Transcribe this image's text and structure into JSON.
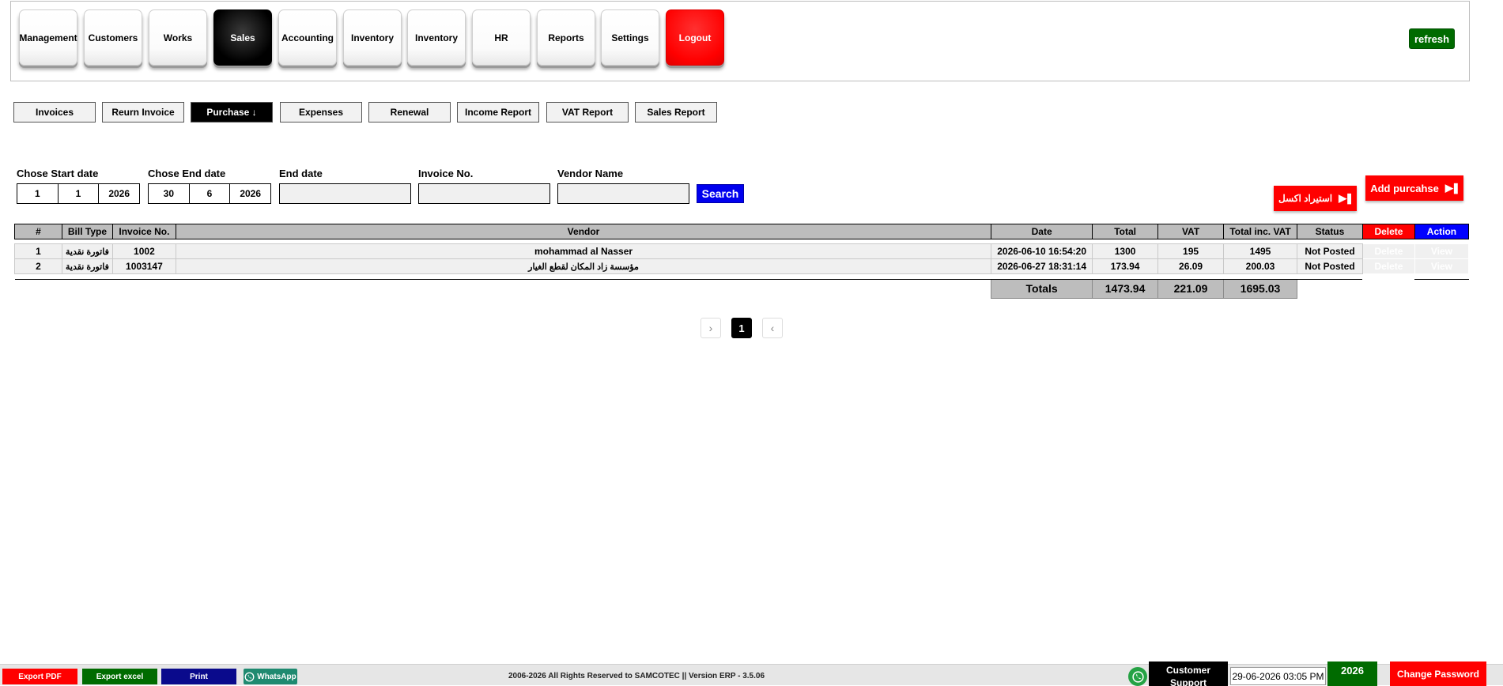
{
  "nav": {
    "items": [
      {
        "label": "Management"
      },
      {
        "label": "Customers"
      },
      {
        "label": "Works"
      },
      {
        "label": "Sales"
      },
      {
        "label": "Accounting"
      },
      {
        "label": "Inventory"
      },
      {
        "label": "Inventory"
      },
      {
        "label": "HR"
      },
      {
        "label": "Reports"
      },
      {
        "label": "Settings"
      }
    ],
    "logout": "Logout",
    "refresh": "refresh"
  },
  "subtabs": [
    {
      "label": "Invoices"
    },
    {
      "label": "Reurn Invoice"
    },
    {
      "label": "Purchase ↓"
    },
    {
      "label": "Expenses"
    },
    {
      "label": "Renewal"
    },
    {
      "label": "Income Report"
    },
    {
      "label": "VAT Report"
    },
    {
      "label": "Sales Report"
    }
  ],
  "filters": {
    "start_label": "Chose Start date",
    "start": {
      "day": "1",
      "month": "1",
      "year": "2026"
    },
    "end_label": "Chose End date",
    "end": {
      "day": "30",
      "month": "6",
      "year": "2026"
    },
    "end_date_label": "End date",
    "invoice_label": "Invoice No.",
    "vendor_label": "Vendor Name",
    "search": "Search"
  },
  "actions": {
    "import_excel": "استيراد اكسل",
    "add_purchase": "Add purcahse"
  },
  "table": {
    "headers": {
      "num": "#",
      "bill_type": "Bill Type",
      "invoice": "Invoice No.",
      "vendor": "Vendor",
      "date": "Date",
      "total": "Total",
      "vat": "VAT",
      "total_inc": "Total inc. VAT",
      "status": "Status",
      "delete": "Delete",
      "action": "Action"
    },
    "rows": [
      {
        "num": "1",
        "bill_type": "فاتورة نقدية",
        "invoice": "1002",
        "vendor": "mohammad al Nasser",
        "date": "2026-06-10 16:54:20",
        "total": "1300",
        "vat": "195",
        "total_inc": "1495",
        "status": "Not Posted",
        "delete": "Delete",
        "view": "View"
      },
      {
        "num": "2",
        "bill_type": "فاتورة نقدية",
        "invoice": "1003147",
        "vendor": "مؤسسة زاد المكان لقطع الغيار",
        "date": "2026-06-27 18:31:14",
        "total": "173.94",
        "vat": "26.09",
        "total_inc": "200.03",
        "status": "Not Posted",
        "delete": "Delete",
        "view": "View"
      }
    ],
    "totals": {
      "label": "Totals",
      "total": "1473.94",
      "vat": "221.09",
      "total_inc": "1695.03"
    }
  },
  "pager": {
    "next": "›",
    "current": "1",
    "prev": "‹"
  },
  "footer": {
    "export_pdf": "Export PDF",
    "export_excel": "Export excel",
    "print": "Print",
    "whatsapp": "WhatsApp",
    "copyright": "2006-2026 All Rights Reserved to SAMCOTEC || Version ERP - 3.5.06",
    "support": "Customer Support",
    "datetime": "29-06-2026 03:05 PM",
    "year": "2026",
    "change_password": "Change Password"
  }
}
